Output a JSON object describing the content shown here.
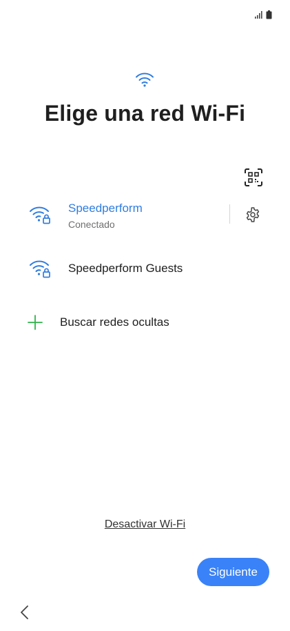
{
  "colors": {
    "accent": "#3a82f7",
    "wifi_icon": "#2f7de0",
    "plus_icon": "#2fb24a",
    "text": "#202020",
    "subtext": "#6f6f6f"
  },
  "status_bar": {
    "icons": [
      "signal-icon",
      "battery-icon"
    ]
  },
  "header": {
    "icon": "wifi-icon",
    "title": "Elige una red Wi-Fi"
  },
  "toolbar": {
    "qr_icon": "qr-scan-icon"
  },
  "networks": [
    {
      "name": "Speedperform",
      "status": "Conectado",
      "secured": true,
      "connected": true,
      "icon": "wifi-lock-icon"
    },
    {
      "name": "Speedperform Guests",
      "status": "",
      "secured": true,
      "connected": false,
      "icon": "wifi-lock-icon"
    }
  ],
  "hidden_networks": {
    "icon": "plus-icon",
    "label": "Buscar redes ocultas"
  },
  "footer": {
    "disable_label": "Desactivar Wi-Fi",
    "next_label": "Siguiente",
    "back_icon": "chevron-left-icon"
  }
}
